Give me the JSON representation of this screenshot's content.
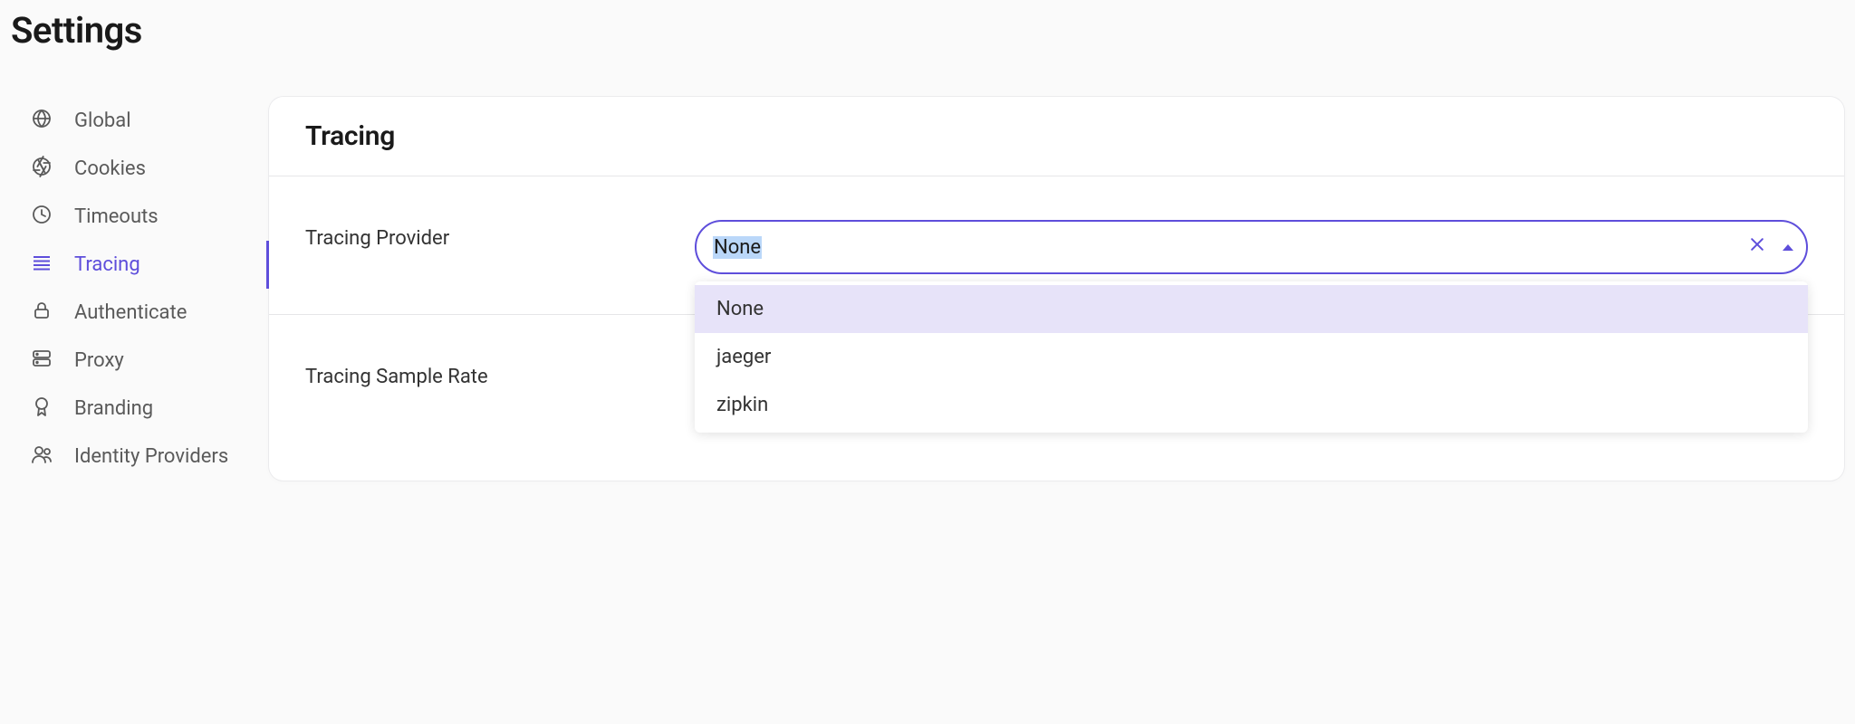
{
  "pageTitle": "Settings",
  "sidebar": {
    "items": [
      {
        "label": "Global",
        "icon": "globe"
      },
      {
        "label": "Cookies",
        "icon": "aperture"
      },
      {
        "label": "Timeouts",
        "icon": "clock"
      },
      {
        "label": "Tracing",
        "icon": "lines",
        "active": true
      },
      {
        "label": "Authenticate",
        "icon": "lock"
      },
      {
        "label": "Proxy",
        "icon": "server"
      },
      {
        "label": "Branding",
        "icon": "award"
      },
      {
        "label": "Identity Providers",
        "icon": "users"
      }
    ]
  },
  "card": {
    "title": "Tracing",
    "fields": {
      "provider": {
        "label": "Tracing Provider",
        "value": "None",
        "options": [
          "None",
          "jaeger",
          "zipkin"
        ],
        "highlightedIndex": 0,
        "open": true
      },
      "sampleRate": {
        "label": "Tracing Sample Rate"
      }
    }
  },
  "colors": {
    "accent": "#5E4EDB",
    "dropdownHighlight": "#E7E3F9",
    "selectionBg": "#BAD7F9"
  }
}
